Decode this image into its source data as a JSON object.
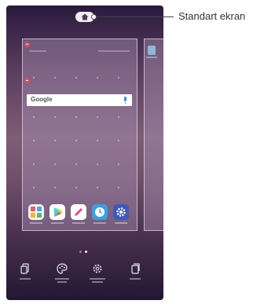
{
  "callout": {
    "label": "Standart ekran"
  },
  "search_widget": {
    "brand": "Google",
    "mic_icon": "mic-icon"
  },
  "home_button": {
    "icon": "home-icon"
  },
  "dock_apps": [
    {
      "name": "apps-folder",
      "color": "#f2f2f2"
    },
    {
      "name": "play-store",
      "color": "#ffffff"
    },
    {
      "name": "qslide-pen",
      "color": "#ffffff"
    },
    {
      "name": "clock",
      "color": "#3aa0e0"
    },
    {
      "name": "settings",
      "color": "#3d5ab8"
    }
  ],
  "bottom_menu": [
    {
      "icon": "widgets-icon"
    },
    {
      "icon": "wallpaper-theme-icon"
    },
    {
      "icon": "home-screen-settings-icon"
    },
    {
      "icon": "app-trays-icon"
    }
  ],
  "colors": {
    "accent_remove": "#e04b5a",
    "google_mic": "#4285f4"
  }
}
